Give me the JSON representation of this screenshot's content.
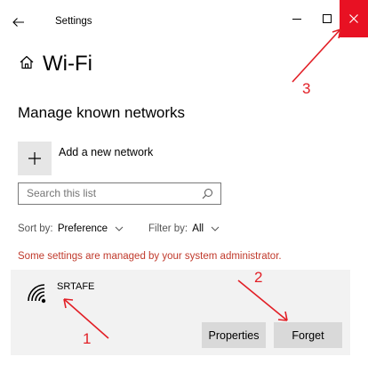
{
  "window": {
    "title": "Settings",
    "back_icon": "back-arrow-icon",
    "controls": [
      "minimize-icon",
      "maximize-icon",
      "close-icon"
    ],
    "close_bg": "#e81123"
  },
  "header": {
    "home_icon": "home-icon",
    "title": "Wi-Fi"
  },
  "manage": {
    "title": "Manage known networks",
    "add_label": "Add a new network",
    "search_placeholder": "Search this list",
    "sort_prefix": "Sort by: ",
    "sort_value": "Preference",
    "filter_prefix": "Filter by: ",
    "filter_value": "All",
    "warning": "Some settings are managed by your system administrator.",
    "warning_color": "#c0392b"
  },
  "network": {
    "name": "SRTAFE",
    "icon": "wifi-icon",
    "properties_label": "Properties",
    "forget_label": "Forget"
  },
  "annotations": {
    "color": "#e21f26",
    "labels": [
      "1",
      "2",
      "3"
    ]
  }
}
